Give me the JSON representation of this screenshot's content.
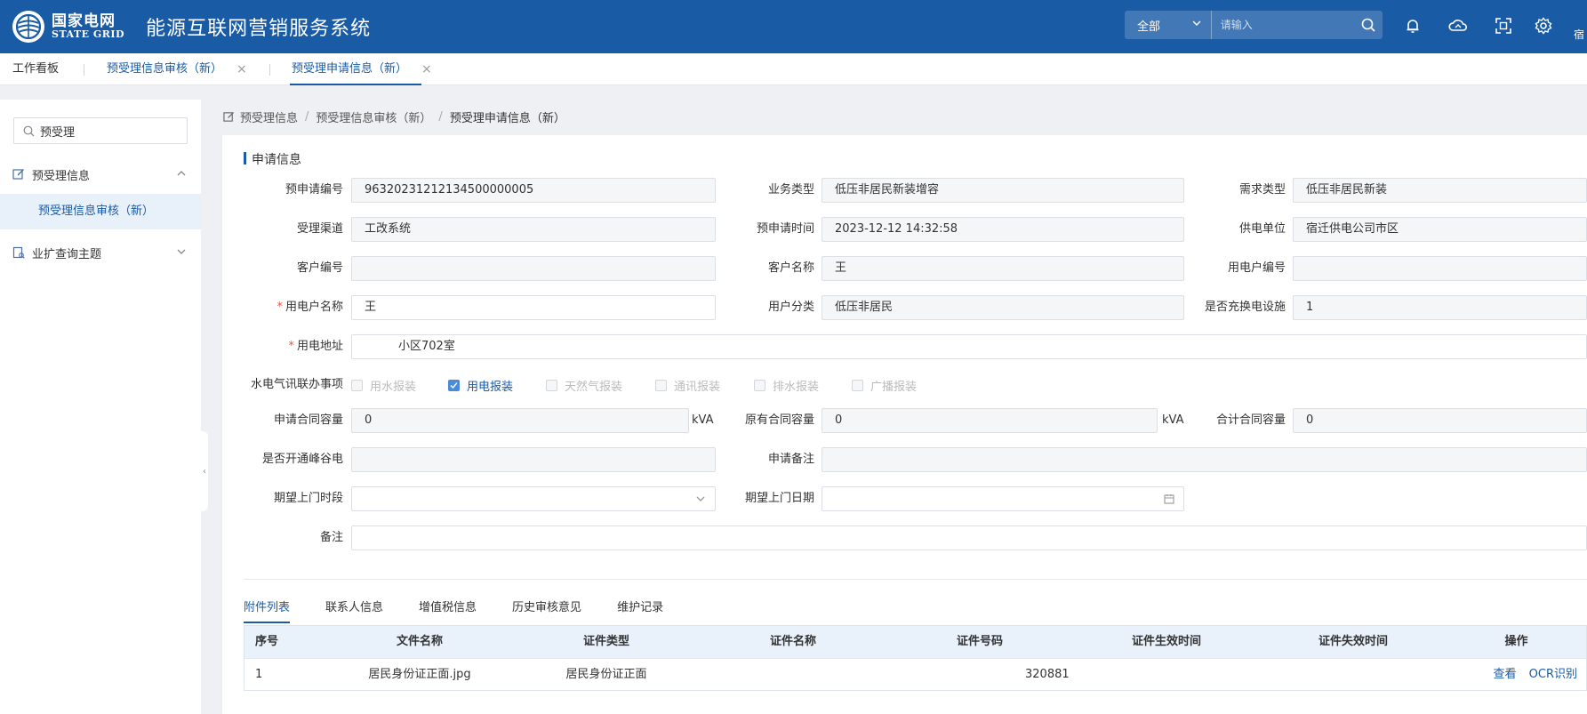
{
  "header": {
    "logo_cn": "国家电网",
    "logo_en": "STATE GRID",
    "app_title": "能源互联网营销服务系统",
    "search_scope": "全部",
    "search_placeholder": "请输入",
    "user_fragment": "宿",
    "icons": [
      "bell-icon",
      "cloud-icon",
      "scan-icon",
      "gear-icon",
      "search-icon"
    ]
  },
  "tabs": {
    "home": "工作看板",
    "items": [
      {
        "label": "预受理信息审核（新）"
      },
      {
        "label": "预受理申请信息（新）"
      }
    ]
  },
  "sidebar": {
    "search_value": "预受理",
    "groups": [
      {
        "label": "预受理信息",
        "expanded": true,
        "children": [
          {
            "label": "预受理信息审核（新）"
          }
        ]
      },
      {
        "label": "业扩查询主题",
        "expanded": false
      }
    ]
  },
  "breadcrumb": [
    "预受理信息",
    "预受理信息审核（新）",
    "预受理申请信息（新）"
  ],
  "form": {
    "section_title": "申请信息",
    "fields": {
      "pre_app_no": {
        "label": "预申请编号",
        "value": "96320231212134500000005"
      },
      "biz_type": {
        "label": "业务类型",
        "value": "低压非居民新装增容"
      },
      "demand_type": {
        "label": "需求类型",
        "value": "低压非居民新装"
      },
      "channel": {
        "label": "受理渠道",
        "value": "工改系统"
      },
      "pre_app_time": {
        "label": "预申请时间",
        "value": "2023-12-12 14:32:58"
      },
      "power_unit": {
        "label": "供电单位",
        "value": "宿迁供电公司市区"
      },
      "cust_no": {
        "label": "客户编号",
        "value": ""
      },
      "cust_name": {
        "label": "客户名称",
        "value": "王"
      },
      "elec_user_no": {
        "label": "用电户编号",
        "value": ""
      },
      "elec_user_name": {
        "label": "用电户名称",
        "value": "王",
        "required": true
      },
      "user_class": {
        "label": "用户分类",
        "value": "低压非居民"
      },
      "charging": {
        "label": "是否充换电设施",
        "value": "1"
      },
      "address": {
        "label": "用电地址",
        "value": "小区702室",
        "required": true
      },
      "apply_cap": {
        "label": "申请合同容量",
        "value": "0",
        "unit": "kVA"
      },
      "orig_cap": {
        "label": "原有合同容量",
        "value": "0",
        "unit": "kVA"
      },
      "total_cap": {
        "label": "合计合同容量",
        "value": "0"
      },
      "peak_valley": {
        "label": "是否开通峰谷电",
        "value": ""
      },
      "apply_remark": {
        "label": "申请备注",
        "value": ""
      },
      "visit_period": {
        "label": "期望上门时段",
        "value": ""
      },
      "visit_date": {
        "label": "期望上门日期",
        "value": ""
      },
      "remark": {
        "label": "备注",
        "value": ""
      }
    },
    "joint": {
      "label": "水电气讯联办事项",
      "options": [
        {
          "label": "用水报装",
          "checked": false
        },
        {
          "label": "用电报装",
          "checked": true
        },
        {
          "label": "天然气报装",
          "checked": false
        },
        {
          "label": "通讯报装",
          "checked": false
        },
        {
          "label": "排水报装",
          "checked": false
        },
        {
          "label": "广播报装",
          "checked": false
        }
      ]
    }
  },
  "bottom_tabs": [
    "附件列表",
    "联系人信息",
    "增值税信息",
    "历史审核意见",
    "维护记录"
  ],
  "table": {
    "headers": [
      "序号",
      "文件名称",
      "证件类型",
      "证件名称",
      "证件号码",
      "证件生效时间",
      "证件失效时间",
      "操作"
    ],
    "rows": [
      {
        "no": "1",
        "file": "居民身份证正面.jpg",
        "cert_type": "居民身份证正面",
        "cert_name": "",
        "cert_no": "320881",
        "valid_from": "",
        "valid_to": "",
        "actions": [
          "查看",
          "OCR识别"
        ]
      }
    ]
  },
  "colors": {
    "brand": "#1a5ba6",
    "required": "#e8543e",
    "table_header": "#e9f1fb"
  }
}
